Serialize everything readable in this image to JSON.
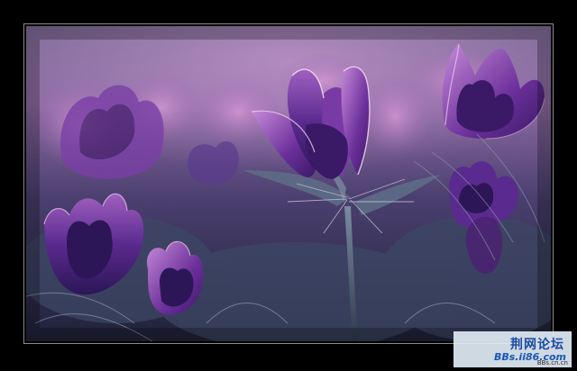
{
  "scene": {
    "subject": "purple pasque flowers",
    "colors": {
      "frame": "#000000",
      "bokeh_light": "#b77fb8",
      "petal_dark": "#3a1e6e",
      "petal_mid": "#6a3a9a",
      "petal_glow": "#d6a4d8",
      "foliage": "#4a5a78"
    }
  },
  "watermark": {
    "title": "荆网论坛",
    "url": "BBs.ii86.com",
    "small": "BBs.cn.cn"
  }
}
